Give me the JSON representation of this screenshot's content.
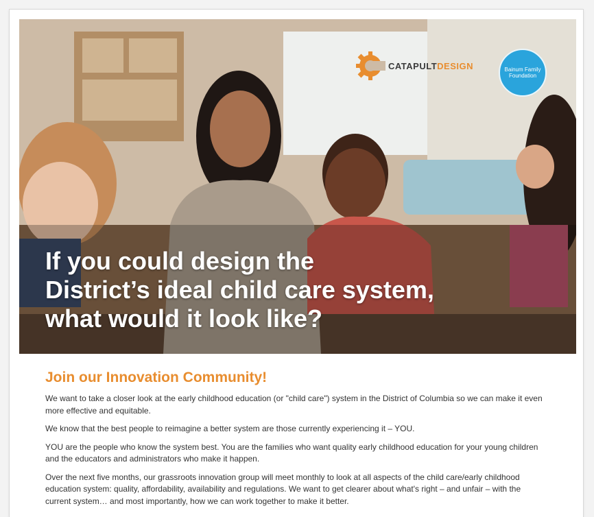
{
  "hero": {
    "headline": [
      "If you could design the",
      "District’s ideal child care system,",
      "what would it look like?"
    ]
  },
  "logos": {
    "catapult": {
      "part1": "CATAPULT",
      "part2": "DESIGN",
      "icon": "gear-c-icon"
    },
    "bainum": {
      "line1": "Bainum Family",
      "line2": "Foundation"
    }
  },
  "colors": {
    "accent_orange": "#e88d2f",
    "bainum_blue": "#2aa4dc",
    "body_text": "#333333"
  },
  "content": {
    "heading": "Join our Innovation Community!",
    "paragraphs": [
      "We want to take a closer look at the early childhood education (or \"child care\") system in the District of Columbia so we can make it even more effective and equitable.",
      "We know that the best people to reimagine a better system are those currently experiencing it – YOU.",
      "YOU are the people who know the system best. You are the families who want quality early childhood education for your young children and the educators and administrators who make it happen.",
      "Over the next five months, our grassroots innovation group will meet monthly to look at all aspects of the child care/early childhood education system: quality, affordability, availability and regulations. We want to get clearer about what's right – and unfair – with the current system… and most importantly, how we can work together to make it better."
    ]
  }
}
